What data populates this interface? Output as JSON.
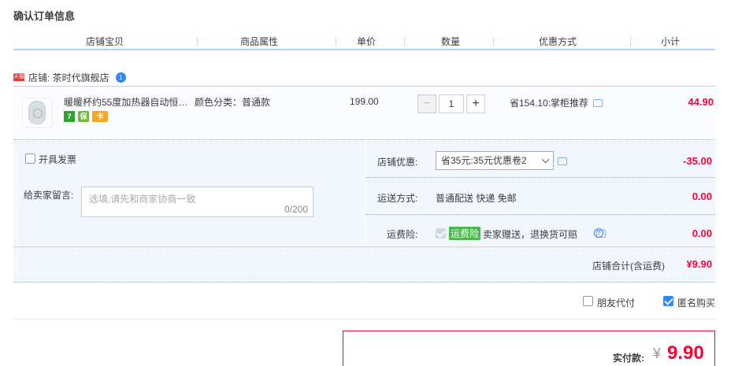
{
  "page_title": "确认订单信息",
  "columns": [
    "店铺宝贝",
    "商品属性",
    "单价",
    "数量",
    "优惠方式",
    "小计"
  ],
  "shop": {
    "badge": "天猫",
    "label": "店铺: 茶时代旗舰店",
    "ww_badge": "1"
  },
  "item": {
    "name": "暖暖杯约55度加热器自动恒…",
    "attribute": "颜色分类：普通款",
    "price": "199.00",
    "quantity": "1",
    "minus": "−",
    "plus": "+",
    "promotion": "省154.10:掌柜推荐",
    "subtotal": "44.90",
    "badges": [
      {
        "icon": "seven-day-return-icon",
        "text": "7",
        "color": "#2fa52f"
      },
      {
        "icon": "guarantee-icon",
        "text": "保",
        "color": "#6fb73f"
      },
      {
        "icon": "card-payment-icon",
        "text": "卡",
        "color": "#f5a623"
      }
    ]
  },
  "invoice": {
    "label": "开具发票",
    "checked": false
  },
  "message": {
    "label": "给卖家留言:",
    "placeholder": "选填,请先和商家协商一致",
    "counter": "0/200"
  },
  "shop_discount": {
    "label": "店铺优惠:",
    "selected": "省35元:35元优惠卷2",
    "amount": "-35.00"
  },
  "shipping": {
    "label": "运送方式:",
    "value": "普通配送 快递 免邮",
    "amount": "0.00"
  },
  "insurance": {
    "label": "运费险:",
    "tag": "运费险",
    "text": "卖家赠送，退换货可赔",
    "amount": "0.00"
  },
  "shop_total": {
    "label": "店铺合计(含运费)",
    "amount": "¥9.90"
  },
  "options": {
    "friend_pay": {
      "label": "朋友代付",
      "checked": false
    },
    "anonymous": {
      "label": "匿名购买",
      "checked": true
    }
  },
  "payment": {
    "label": "实付款:",
    "currency": "¥",
    "amount": "9.90"
  },
  "colors": {
    "accent_red": "#ff0036",
    "border_blue": "#b2d1ff",
    "panel_bg": "#f2f7ff"
  }
}
